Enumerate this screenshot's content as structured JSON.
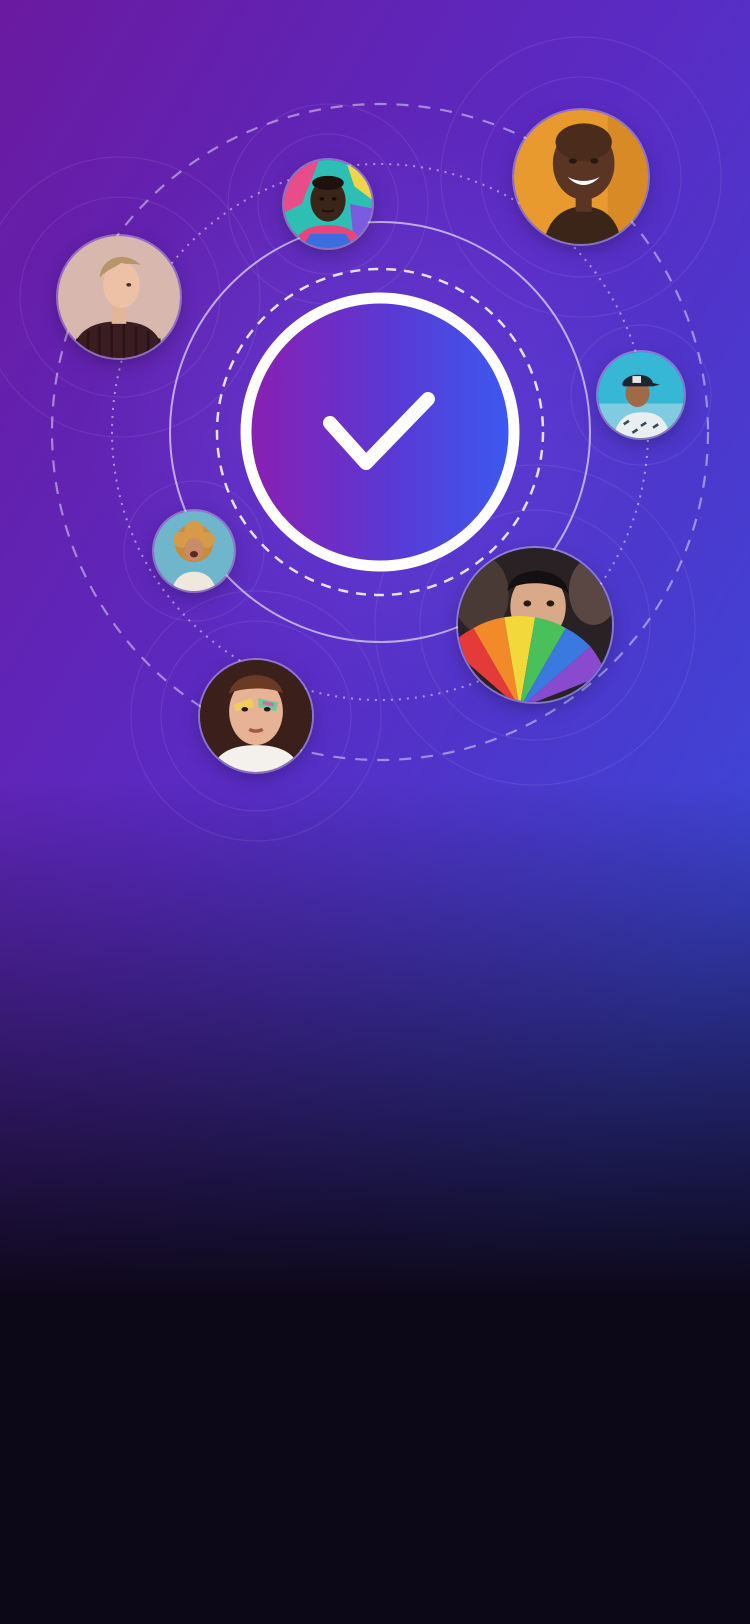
{
  "screen": {
    "title": "",
    "colors": {
      "gradient_start": "#6a1aa0",
      "gradient_mid": "#5a2bc4",
      "gradient_end": "#3d46d6",
      "bottom_dark": "#0d0818",
      "ring": "#ffffff"
    }
  },
  "hero": {
    "badge_icon": "checkmark-icon",
    "badge_state": "verified"
  },
  "avatars": [
    {
      "name": "avatar-smiling-woman-orange-background",
      "icon": "person-photo"
    },
    {
      "name": "avatar-man-graffiti-background",
      "icon": "person-photo"
    },
    {
      "name": "avatar-blond-man-sweater",
      "icon": "person-photo"
    },
    {
      "name": "avatar-man-cap-sky",
      "icon": "person-photo"
    },
    {
      "name": "avatar-curly-hair-woman",
      "icon": "person-photo"
    },
    {
      "name": "avatar-person-rainbow-fan",
      "icon": "person-photo"
    },
    {
      "name": "avatar-man-rainbow-light",
      "icon": "person-photo"
    }
  ]
}
